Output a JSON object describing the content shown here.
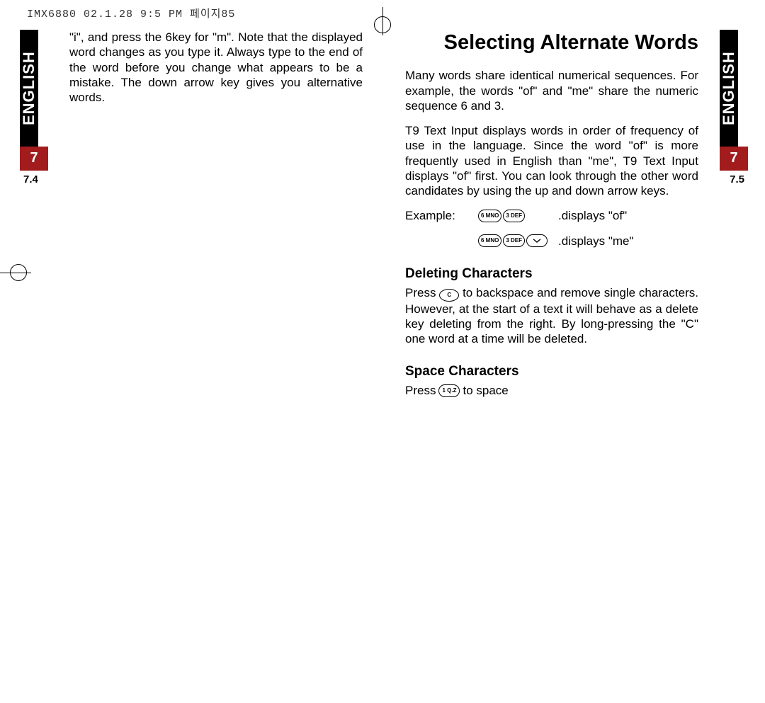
{
  "header": {
    "scan_info": "IMX6880 02.1.28 9:5  PM   페이지85"
  },
  "left_tab": {
    "lang": "ENGLISH",
    "chapter": "7",
    "section": "7.4"
  },
  "right_tab": {
    "lang": "ENGLISH",
    "chapter": "7",
    "section": "7.5"
  },
  "left_col": {
    "p1": "\"i\", and press the 6key for \"m\". Note that the displayed word changes as you type it. Always type to the end of the word before you change what appears to be a mistake. The down arrow key gives you alternative words."
  },
  "right_col": {
    "title": "Selecting Alternate Words",
    "p1": "Many words share identical numerical sequences. For example, the words \"of\" and \"me\" share the numeric sequence 6 and 3.",
    "p2": "T9 Text Input displays words in order of frequency of use in the language. Since the word \"of\" is more frequently used in English than \"me\", T9 Text Input displays \"of\" first. You can look through the other word candidates by using the up and down arrow keys.",
    "example_label": "Example:",
    "example1_keys": [
      "6 MNO",
      "3 DEF"
    ],
    "example1_result": ".displays \"of\"",
    "example2_keys": [
      "6 MNO",
      "3 DEF",
      "down"
    ],
    "example2_result": ".displays \"me\"",
    "h_delete": "Deleting Characters",
    "p_delete_a": "Press",
    "p_delete_key": "C",
    "p_delete_b": "to backspace and remove single characters. However, at the start of a text it will behave as a delete key deleting from the right. By long-pressing the \"C\" one word at a time will be deleted.",
    "h_space": "Space Characters",
    "p_space_a": "Press",
    "p_space_key": "1 Q.Z",
    "p_space_b": "to space"
  }
}
